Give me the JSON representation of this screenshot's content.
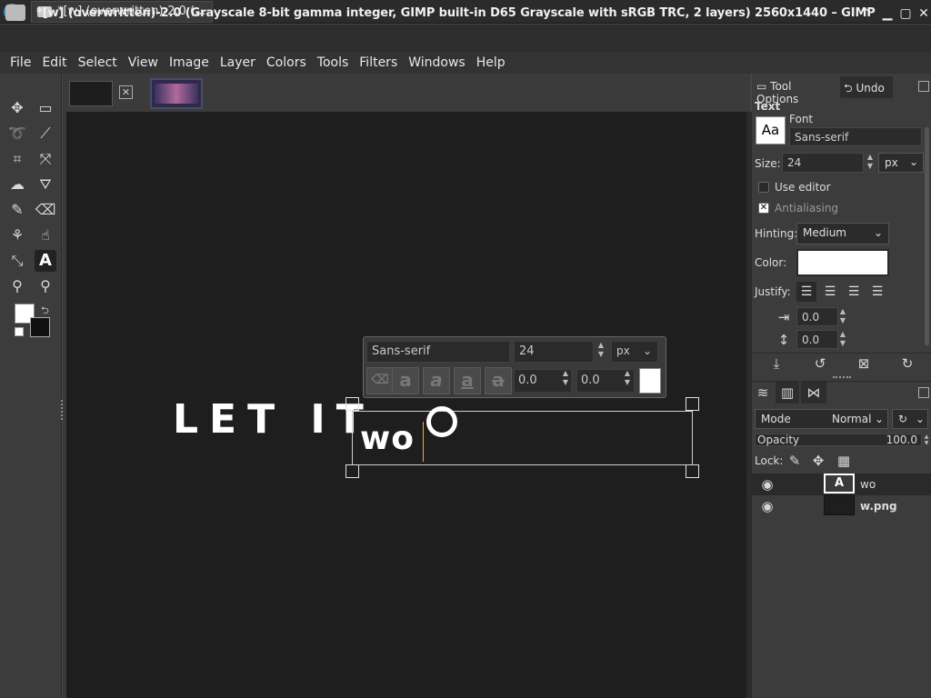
{
  "taskbar": {
    "item_title": "*[w] (overwritten)-2.0 (..."
  },
  "window": {
    "title": "*[w] (overwritten)-2.0 (Grayscale 8-bit gamma integer, GIMP built-in D65 Grayscale with sRGB TRC, 2 layers) 2560x1440 – GIMP"
  },
  "menu": [
    "File",
    "Edit",
    "Select",
    "View",
    "Image",
    "Layer",
    "Colors",
    "Tools",
    "Filters",
    "Windows",
    "Help"
  ],
  "canvas": {
    "text_line_1": "LET IT",
    "text_editing": "wo"
  },
  "text_toolbar": {
    "font": "Sans-serif",
    "size": "24",
    "unit": "px",
    "kerning": "0.0",
    "baseline": "0.0",
    "style_buttons": [
      "a",
      "a",
      "a",
      "a"
    ]
  },
  "tool_options": {
    "tabs": {
      "tool_options": "Tool Options",
      "undo": "Undo"
    },
    "section_title": "Text",
    "font_label": "Font",
    "font_preview": "Aa",
    "font_value": "Sans-serif",
    "size_label": "Size:",
    "size_value": "24",
    "size_unit": "px",
    "use_editor": "Use editor",
    "antialiasing": "Antialiasing",
    "hinting_label": "Hinting:",
    "hinting_value": "Medium",
    "color_label": "Color:",
    "color_value": "#ffffff",
    "justify_label": "Justify:",
    "indent_value": "0.0",
    "line_spacing_value": "0.0"
  },
  "layers": {
    "mode_label": "Mode",
    "mode_value": "Normal",
    "opacity_label": "Opacity",
    "opacity_value": "100.0",
    "lock_label": "Lock:",
    "items": [
      {
        "name": "wo",
        "selected": true
      },
      {
        "name": "w.png",
        "selected": false
      }
    ]
  },
  "colors": {
    "foreground": "#ffffff",
    "background": "#111111"
  }
}
